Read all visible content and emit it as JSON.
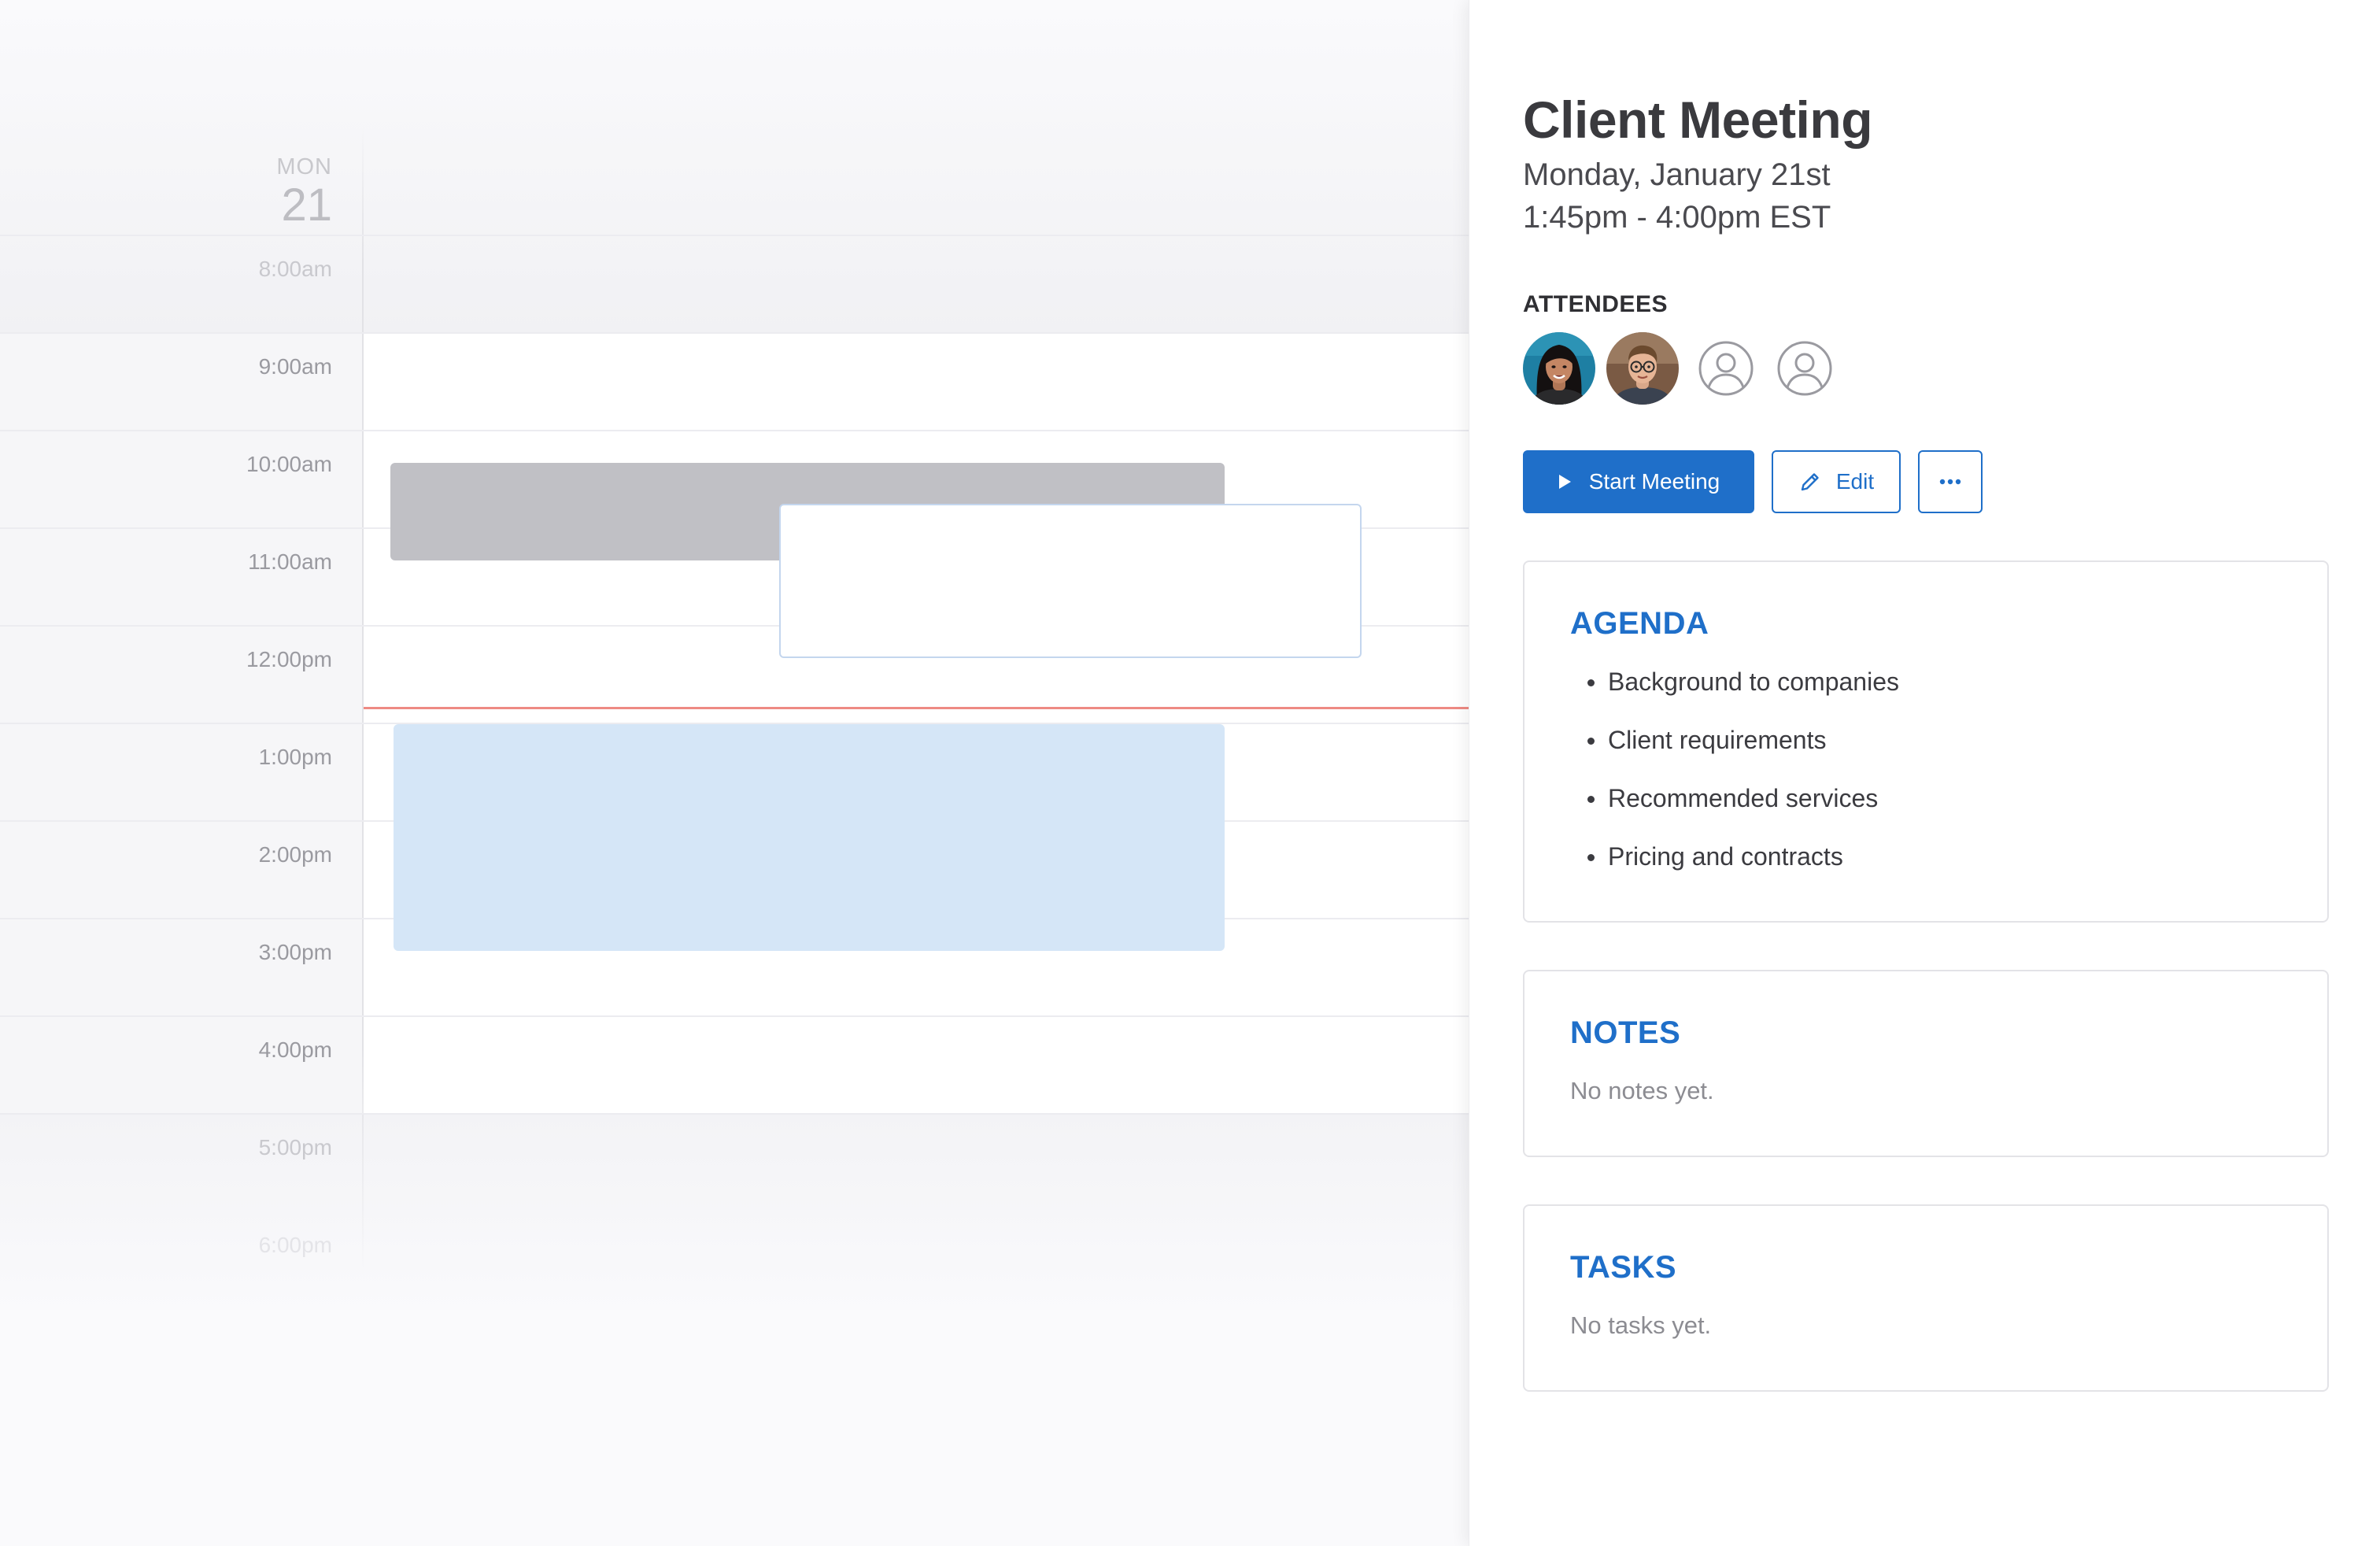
{
  "calendar": {
    "day_name": "MON",
    "day_number": "21",
    "time_labels": [
      "8:00am",
      "9:00am",
      "10:00am",
      "11:00am",
      "12:00pm",
      "1:00pm",
      "2:00pm",
      "3:00pm",
      "4:00pm",
      "5:00pm",
      "6:00pm"
    ]
  },
  "event": {
    "title": "Client Meeting",
    "date": "Monday, January 21st",
    "time": "1:45pm - 4:00pm EST",
    "attendees_label": "ATTENDEES",
    "attendees": [
      {
        "type": "photo",
        "icon": "avatar-photo-woman"
      },
      {
        "type": "photo",
        "icon": "avatar-photo-man"
      },
      {
        "type": "placeholder",
        "icon": "user-circle-icon"
      },
      {
        "type": "placeholder",
        "icon": "user-circle-icon"
      }
    ],
    "actions": {
      "start_label": "Start Meeting",
      "edit_label": "Edit",
      "more_icon": "ellipsis-icon"
    }
  },
  "agenda": {
    "title": "AGENDA",
    "items": [
      "Background to companies",
      "Client requirements",
      "Recommended services",
      "Pricing and contracts"
    ]
  },
  "notes": {
    "title": "NOTES",
    "empty_text": "No notes yet."
  },
  "tasks": {
    "title": "TASKS",
    "empty_text": "No tasks yet."
  },
  "colors": {
    "accent": "#1f6fc9",
    "now_line": "#ee8a83",
    "event_gray": "#c0c0c5",
    "event_blue": "#d5e6f7"
  }
}
